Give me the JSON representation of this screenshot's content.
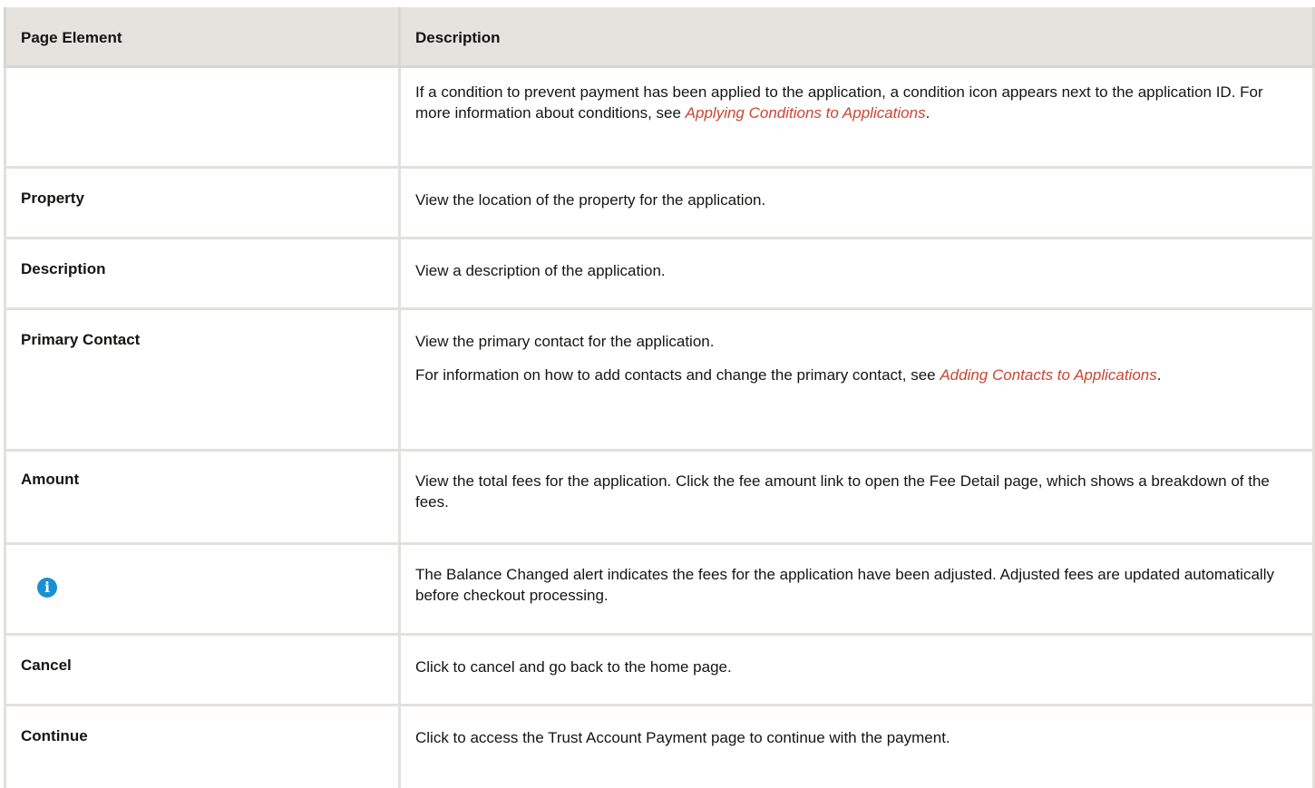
{
  "table": {
    "headers": {
      "element": "Page Element",
      "description": "Description"
    },
    "rows": [
      {
        "element": "",
        "desc_pre": "If a condition to prevent payment has been applied to the application, a condition icon appears next to the application ID. For more information about conditions, see ",
        "desc_link": "Applying Conditions to Applications",
        "desc_post": "."
      },
      {
        "element": "Property",
        "desc": "View the location of the property for the application."
      },
      {
        "element": "Description",
        "desc": "View a description of the application."
      },
      {
        "element": "Primary Contact",
        "desc": "View the primary contact for the application.",
        "desc2_pre": "For information on how to add contacts and change the primary contact, see ",
        "desc2_link": "Adding Contacts to Applications",
        "desc2_post": "."
      },
      {
        "element": "Amount",
        "desc": "View the total fees for the application. Click the fee amount link to open the Fee Detail page, which shows a breakdown of the fees."
      },
      {
        "element_icon": "info-icon",
        "desc": "The Balance Changed alert indicates the fees for the application have been adjusted. Adjusted fees are updated automatically before checkout processing."
      },
      {
        "element": "Cancel",
        "desc": "Click to cancel and go back to the home page."
      },
      {
        "element": "Continue",
        "desc": "Click to access the Trust Account Payment page to continue with the payment."
      }
    ]
  },
  "colors": {
    "header_bg": "#e6e3df",
    "border": "#e3e0dc",
    "link": "#c74634",
    "info_icon": "#1a8fd1"
  }
}
